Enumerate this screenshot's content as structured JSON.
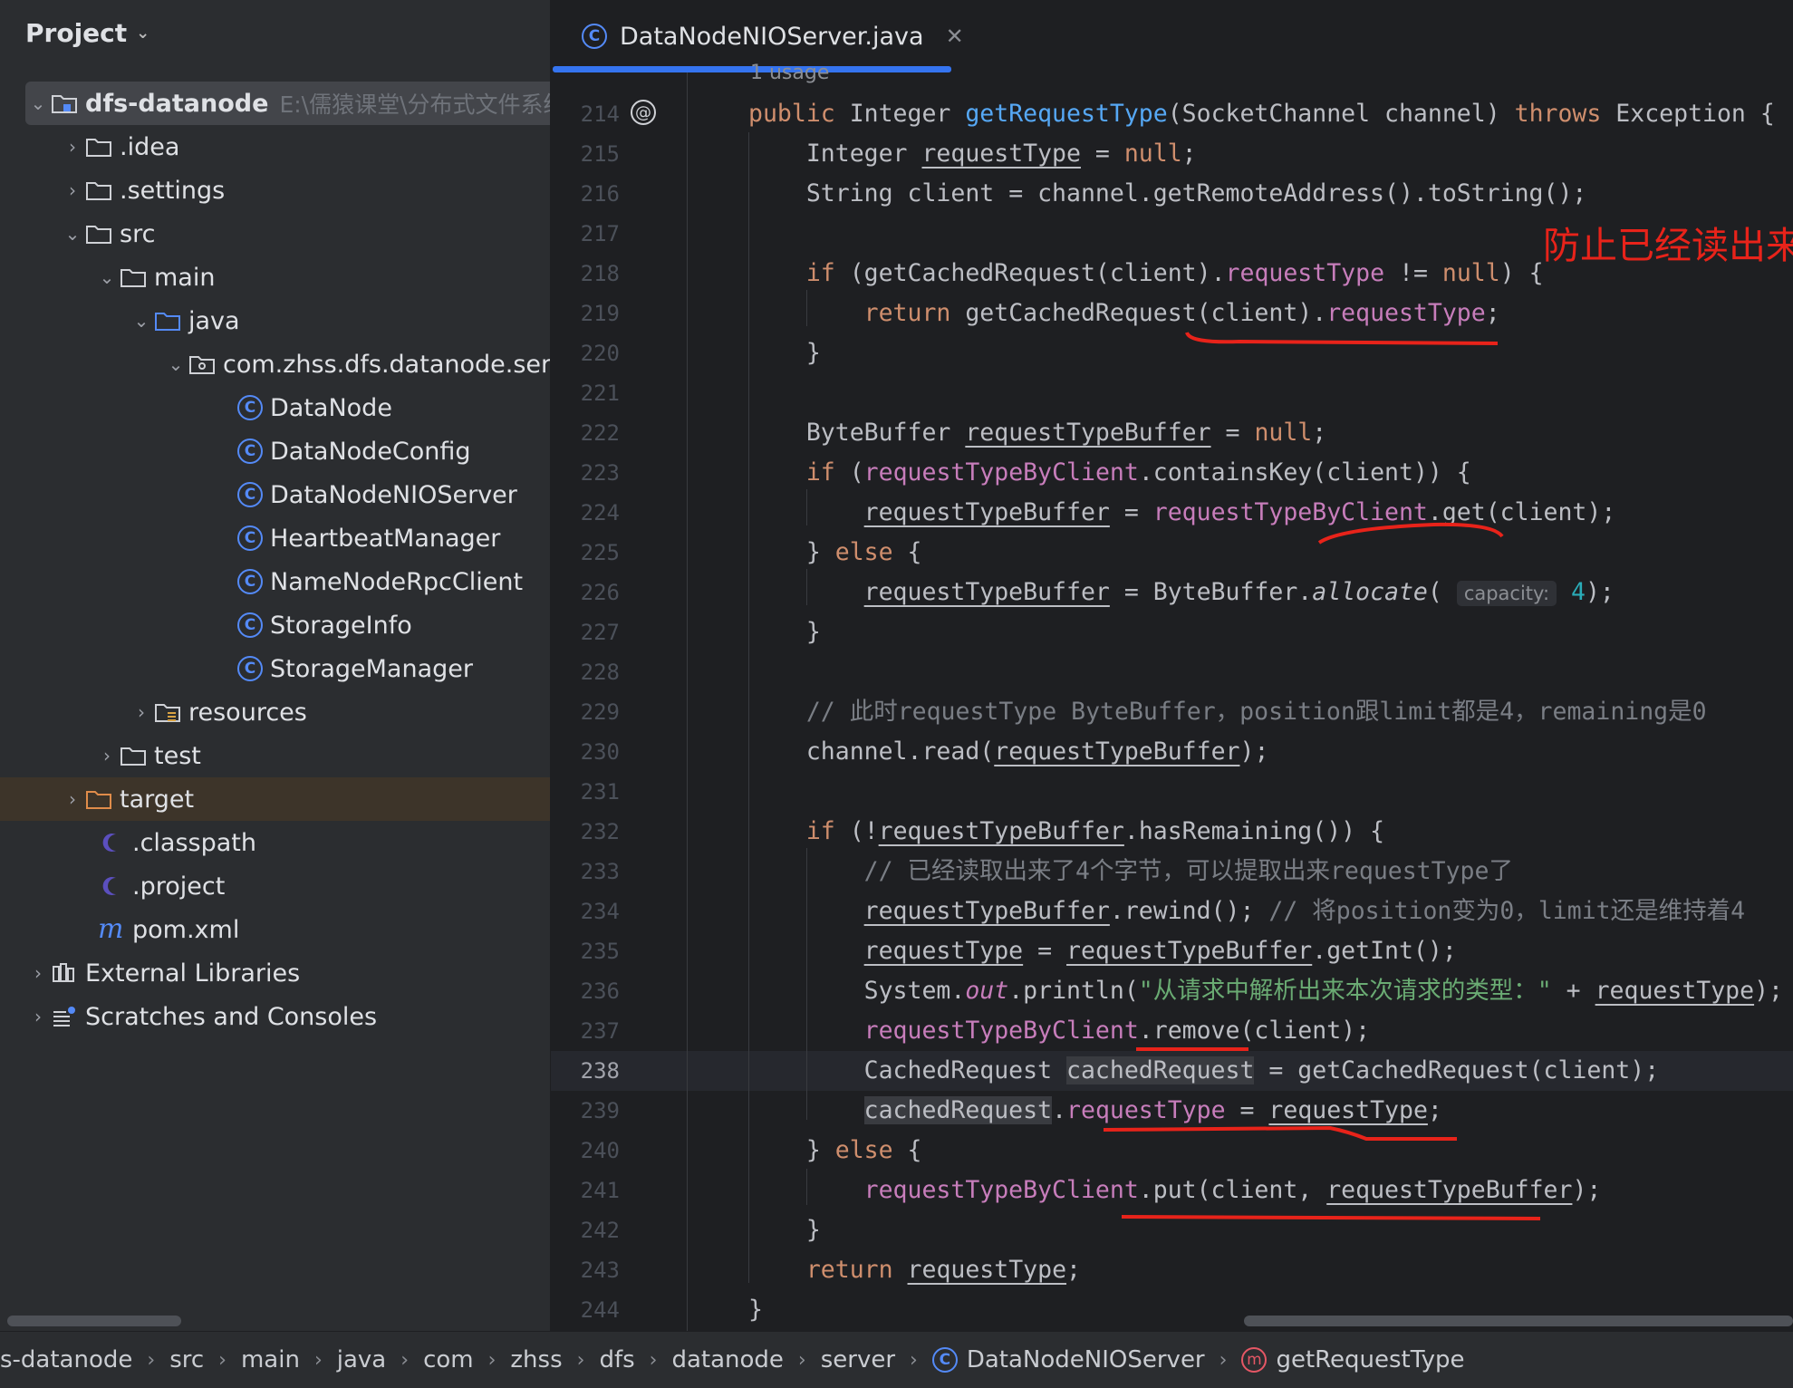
{
  "project": {
    "title": "Project",
    "tree": [
      {
        "label": "dfs-datanode",
        "path": "E:\\儒猿课堂\\分布式文件系统"
      },
      {
        "label": ".idea"
      },
      {
        "label": ".settings"
      },
      {
        "label": "src"
      },
      {
        "label": "main"
      },
      {
        "label": "java"
      },
      {
        "label": "com.zhss.dfs.datanode.server"
      },
      {
        "label": "DataNode"
      },
      {
        "label": "DataNodeConfig"
      },
      {
        "label": "DataNodeNIOServer"
      },
      {
        "label": "HeartbeatManager"
      },
      {
        "label": "NameNodeRpcClient"
      },
      {
        "label": "StorageInfo"
      },
      {
        "label": "StorageManager"
      },
      {
        "label": "resources"
      },
      {
        "label": "test"
      },
      {
        "label": "target"
      },
      {
        "label": ".classpath"
      },
      {
        "label": ".project"
      },
      {
        "label": "pom.xml"
      },
      {
        "label": "External Libraries"
      },
      {
        "label": "Scratches and Consoles"
      }
    ]
  },
  "editor": {
    "tab_title": "DataNodeNIOServer.java",
    "usage_hint": "1 usage",
    "current_line": 238,
    "annotation": "防止已经读出来的东西，又重新被读取",
    "line_numbers": [
      "214",
      "215",
      "216",
      "217",
      "218",
      "219",
      "220",
      "221",
      "222",
      "223",
      "224",
      "225",
      "226",
      "227",
      "228",
      "229",
      "230",
      "231",
      "232",
      "233",
      "234",
      "235",
      "236",
      "237",
      "238",
      "239",
      "240",
      "241",
      "242",
      "243",
      "244"
    ],
    "code": {
      "l214": {
        "a": "public",
        "b": " Integer ",
        "c": "getRequestType",
        "d": "(SocketChannel channel) ",
        "e": "throws",
        "f": " Exception {"
      },
      "l215": {
        "a": "Integer ",
        "b": "requestType",
        "c": " = ",
        "d": "null",
        "e": ";"
      },
      "l216": {
        "a": "String client = channel.getRemoteAddress().toString();"
      },
      "l218": {
        "a": "if",
        "b": " (getCachedRequest(client).",
        "c": "requestType",
        "d": " != ",
        "e": "null",
        "f": ") {"
      },
      "l219": {
        "a": "return",
        "b": " getCachedRequest(client).",
        "c": "requestType",
        "d": ";"
      },
      "l220": {
        "a": "}"
      },
      "l222": {
        "a": "ByteBuffer ",
        "b": "requestTypeBuffer",
        "c": " = ",
        "d": "null",
        "e": ";"
      },
      "l223": {
        "a": "if",
        "b": " (",
        "c": "requestTypeByClient",
        "d": ".containsKey(client)) {"
      },
      "l224": {
        "a": "requestTypeBuffer",
        "b": " = ",
        "c": "requestTypeByClient",
        "d": ".get(client);"
      },
      "l225": {
        "a": "} ",
        "b": "else",
        "c": " {"
      },
      "l226": {
        "a": "requestTypeBuffer",
        "b": " = ByteBuffer.",
        "c": "allocate",
        "d": "( ",
        "e": "capacity:",
        "f": " ",
        "g": "4",
        "h": ");"
      },
      "l227": {
        "a": "}"
      },
      "l229": {
        "a": "// 此时requestType ByteBuffer，position跟limit都是4，remaining是0"
      },
      "l230": {
        "a": "channel.read(",
        "b": "requestTypeBuffer",
        "c": ");"
      },
      "l232": {
        "a": "if",
        "b": " (!",
        "c": "requestTypeBuffer",
        "d": ".hasRemaining()) {"
      },
      "l233": {
        "a": "// 已经读取出来了4个字节，可以提取出来requestType了"
      },
      "l234": {
        "a": "requestTypeBuffer",
        "b": ".rewind(); ",
        "c": "// 将position变为0，limit还是维持着4"
      },
      "l235": {
        "a": "requestType",
        "b": " = ",
        "c": "requestTypeBuffer",
        "d": ".getInt();"
      },
      "l236": {
        "a": "System.",
        "b": "out",
        "c": ".println(",
        "d": "\"从请求中解析出来本次请求的类型：\"",
        "e": " + ",
        "f": "requestType",
        "g": ");"
      },
      "l237": {
        "a": "requestTypeByClient",
        "b": ".remove(client);"
      },
      "l238": {
        "a": "CachedRequest ",
        "b": "cachedRequest",
        "c": " = getCachedRequest(client);"
      },
      "l239": {
        "a": "cachedRequest",
        "b": ".",
        "c": "requestType",
        "d": " = ",
        "e": "requestType",
        "f": ";"
      },
      "l240": {
        "a": "} ",
        "b": "else",
        "c": " {"
      },
      "l241": {
        "a": "requestTypeByClient",
        "b": ".put(client, ",
        "c": "requestTypeBuffer",
        "d": ");"
      },
      "l242": {
        "a": "}"
      },
      "l243": {
        "a": "return",
        "b": " ",
        "c": "requestType",
        "d": ";"
      },
      "l244": {
        "a": "}"
      }
    }
  },
  "breadcrumb": [
    "s-datanode",
    "src",
    "main",
    "java",
    "com",
    "zhss",
    "dfs",
    "datanode",
    "server",
    "DataNodeNIOServer",
    "getRequestType"
  ],
  "colors": {
    "keyword": "#cf8e6d",
    "method": "#56a8f5",
    "field": "#c77dbb",
    "comment": "#7a7e85",
    "string": "#6aab73",
    "annotation_red": "#e8231a",
    "accent": "#3574f0"
  }
}
